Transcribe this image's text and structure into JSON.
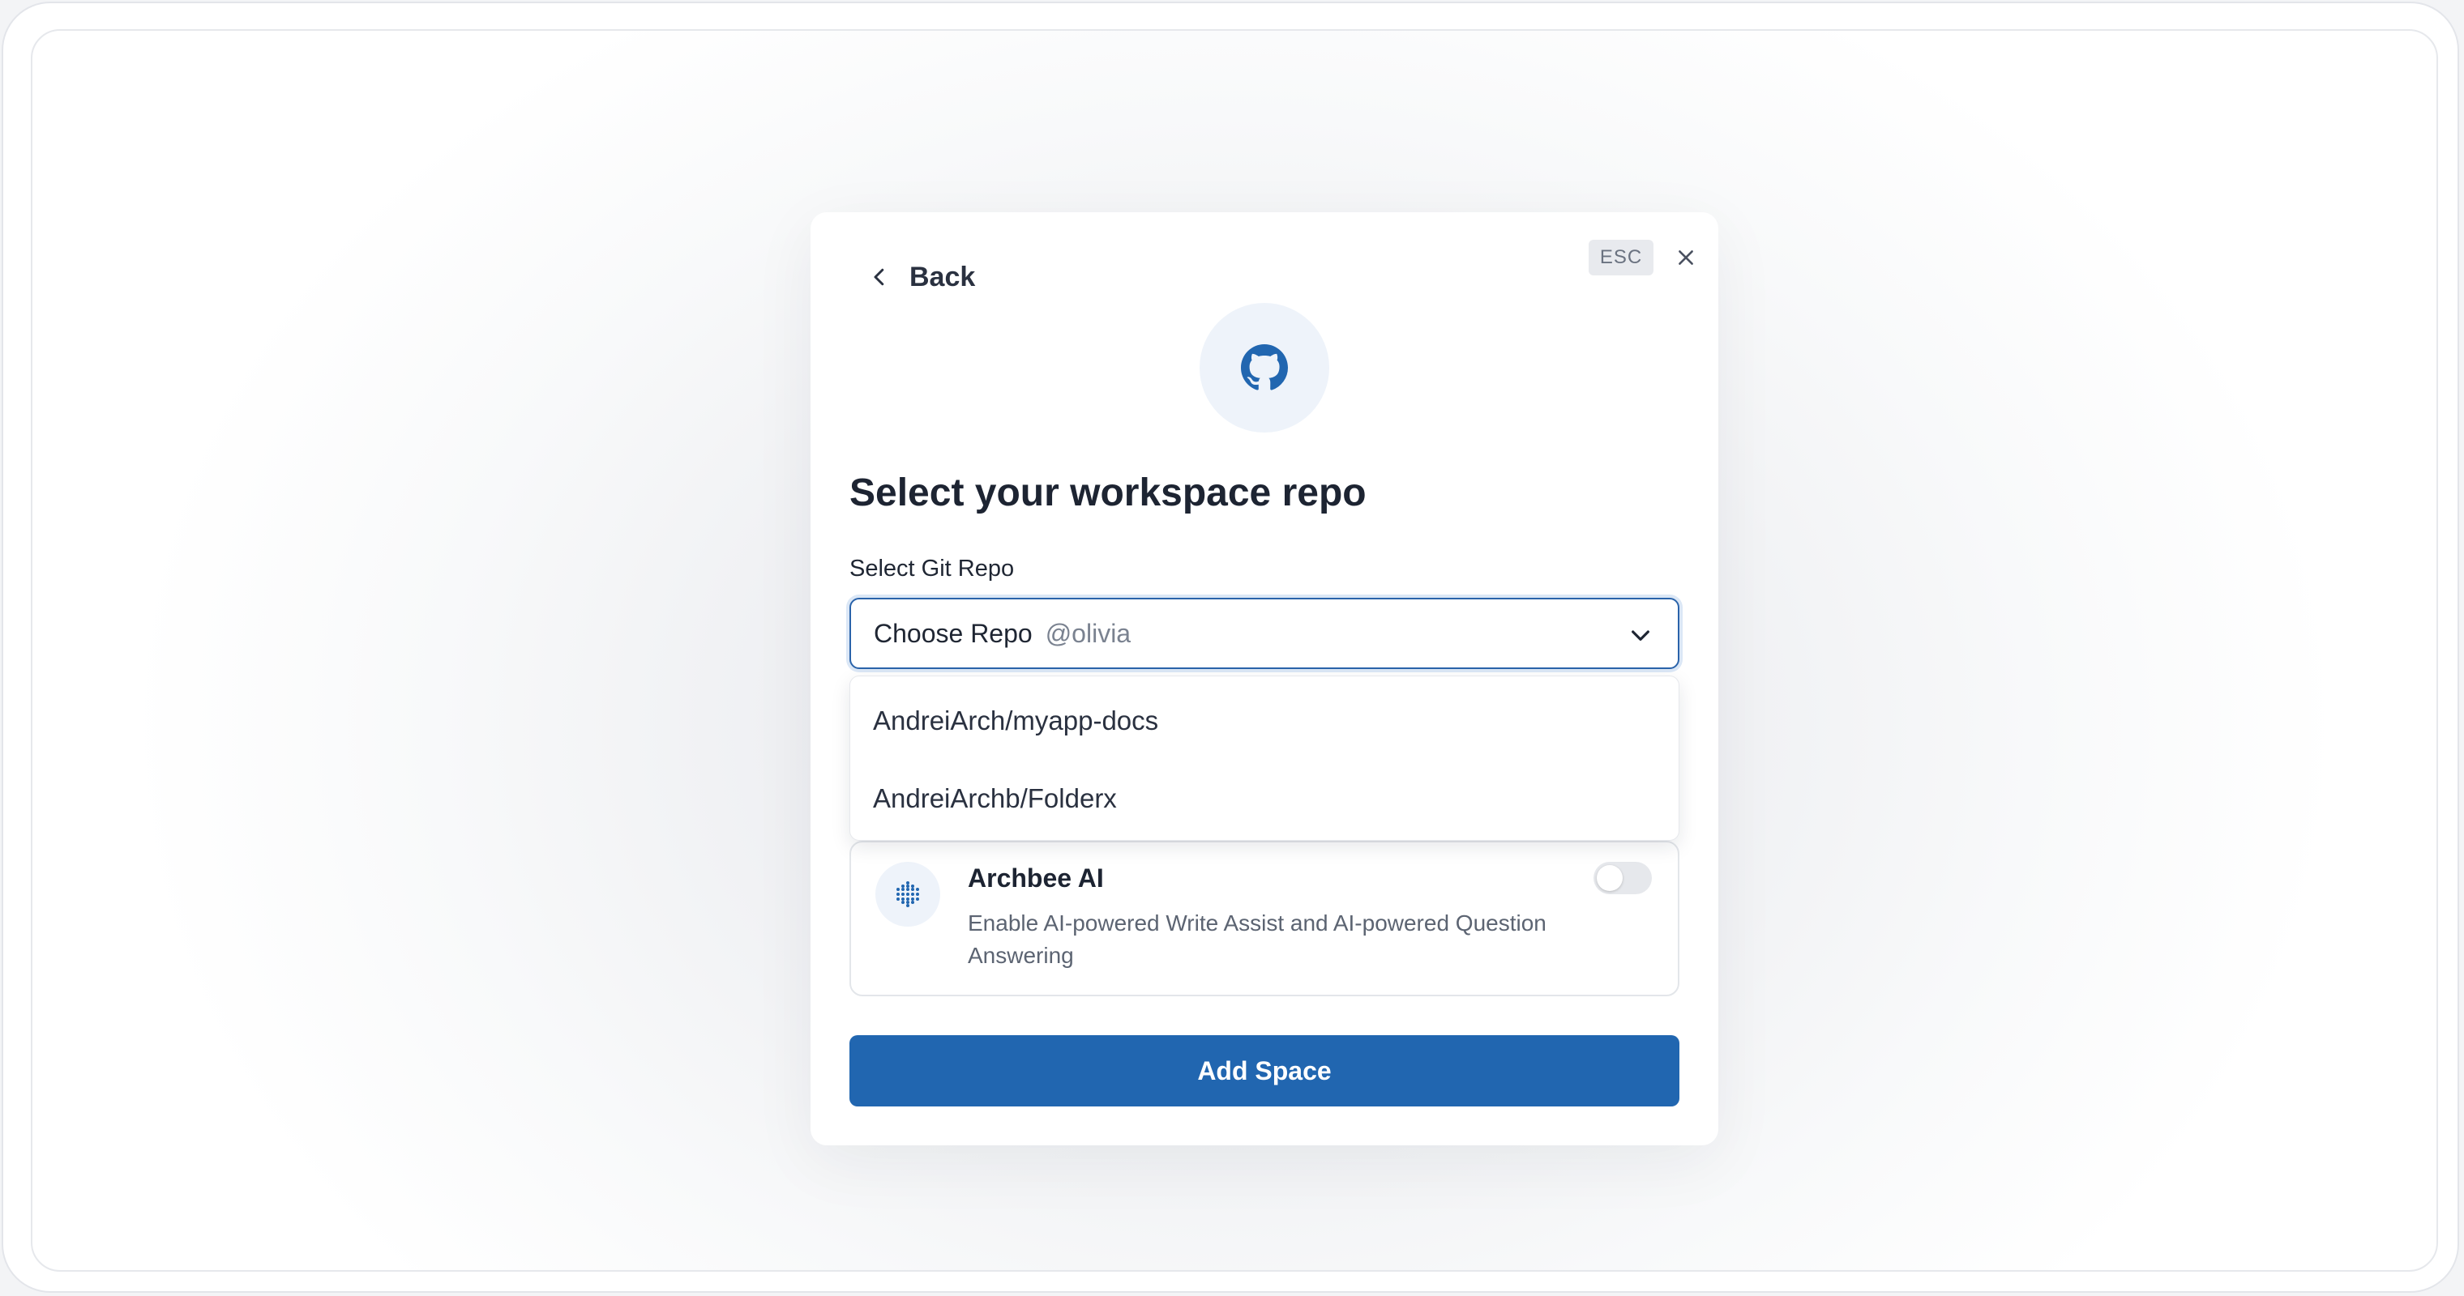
{
  "modal": {
    "back_label": "Back",
    "esc_label": "ESC",
    "title": "Select your workspace repo",
    "icon": "github-icon"
  },
  "repo_select": {
    "label": "Select Git Repo",
    "value": "Choose Repo",
    "account": "@olivia",
    "options": [
      "AndreiArch/myapp-docs",
      "AndreiArchb/Folderx"
    ]
  },
  "ai_card": {
    "title": "Archbee AI",
    "description": "Enable AI-powered Write Assist and AI-powered Question Answering",
    "enabled": false
  },
  "submit": {
    "label": "Add Space"
  },
  "colors": {
    "primary": "#2166b0",
    "focus_border": "#2a63aa",
    "icon_bg": "#eef3fa"
  }
}
